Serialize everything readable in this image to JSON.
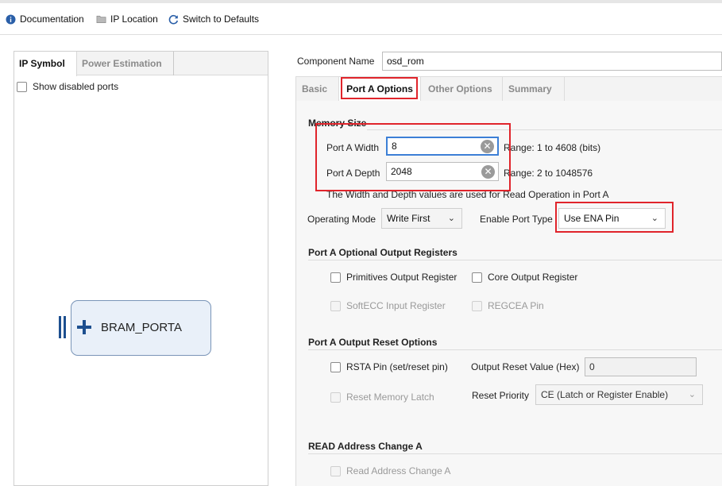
{
  "toolbar": {
    "documentation": "Documentation",
    "ip_location": "IP Location",
    "switch_defaults": "Switch to Defaults"
  },
  "left": {
    "tabs": [
      "IP Symbol",
      "Power Estimation"
    ],
    "show_disabled": "Show disabled ports",
    "block_label": "BRAM_PORTA"
  },
  "component": {
    "label": "Component Name",
    "value": "osd_rom"
  },
  "tabs": [
    "Basic",
    "Port A Options",
    "Other Options",
    "Summary"
  ],
  "memory_size": {
    "title": "Memory Size",
    "width_label": "Port A Width",
    "width_value": "8",
    "width_range": "Range: 1 to 4608 (bits)",
    "depth_label": "Port A Depth",
    "depth_value": "2048",
    "depth_range": "Range: 2 to 1048576",
    "note": "The Width and Depth values are used for Read Operation in Port A"
  },
  "operating_mode": {
    "label": "Operating Mode",
    "value": "Write First"
  },
  "enable_port": {
    "label": "Enable Port Type",
    "value": "Use ENA Pin"
  },
  "output_registers": {
    "title": "Port A Optional Output Registers",
    "primitives": "Primitives Output Register",
    "core": "Core Output Register",
    "softecc": "SoftECC Input Register",
    "regcea": "REGCEA Pin"
  },
  "reset_options": {
    "title": "Port A Output Reset Options",
    "rsta": "RSTA Pin (set/reset pin)",
    "reset_value_label": "Output Reset Value (Hex)",
    "reset_value": "0",
    "reset_latch": "Reset Memory Latch",
    "priority_label": "Reset Priority",
    "priority_value": "CE (Latch or Register Enable)"
  },
  "read_address": {
    "title": "READ Address Change A",
    "checkbox": "Read Address Change A"
  },
  "colors": {
    "highlight": "#e0242b",
    "focus": "#3c7fd6",
    "block_fill": "#e9f0f9",
    "plus": "#1d4f8f"
  }
}
